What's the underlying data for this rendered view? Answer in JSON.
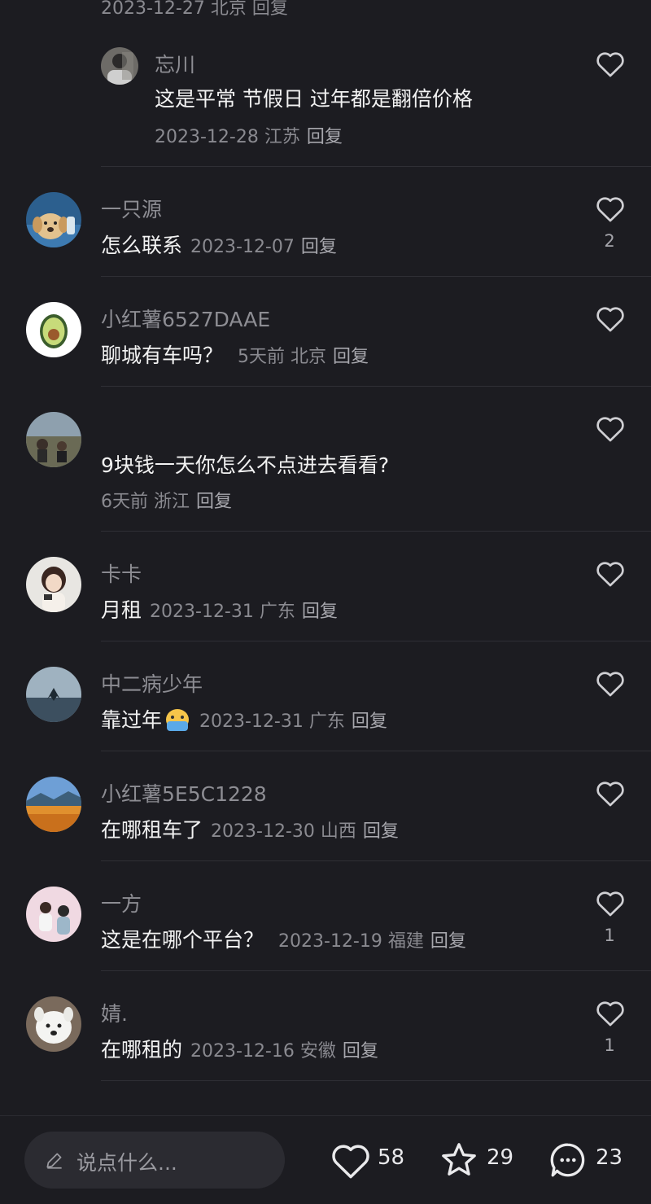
{
  "partial_top_meta": "2023-12-27 北京 回复",
  "reply_label": "回复",
  "sub_comment": {
    "name": "忘川",
    "text": "这是平常  节假日  过年都是翻倍价格",
    "meta": "2023-12-28 江苏"
  },
  "comments": [
    {
      "name": "一只源",
      "text": "怎么联系",
      "meta": "2023-12-07",
      "likes": "2",
      "avatar": "golden-retriever"
    },
    {
      "name": "小红薯6527DAAE",
      "text": "聊城有车吗？",
      "meta": "5天前 北京",
      "likes": "",
      "avatar": "avocado"
    },
    {
      "name": "",
      "text": "9块钱一天你怎么不点进去看看?",
      "meta": "6天前 浙江",
      "likes": "",
      "avatar": "landscape-people"
    },
    {
      "name": "卡卡",
      "text": "月租",
      "meta": "2023-12-31 广东",
      "likes": "",
      "avatar": "girl-camera"
    },
    {
      "name": "中二病少年",
      "text": "靠过年",
      "emoji": "crying-face-emoji",
      "meta": "2023-12-31 广东",
      "likes": "",
      "avatar": "whale"
    },
    {
      "name": "小红薯5E5C1228",
      "text": "在哪租车了",
      "meta": "2023-12-30 山西",
      "likes": "",
      "avatar": "flower-field"
    },
    {
      "name": "一方",
      "text": "这是在哪个平台？",
      "meta": "2023-12-19 福建",
      "likes": "1",
      "avatar": "couple-photo"
    },
    {
      "name": " 婧.",
      "text": "在哪租的",
      "meta": "2023-12-16 安徽",
      "likes": "1",
      "avatar": "samoyed"
    }
  ],
  "bottom_bar": {
    "input_placeholder": "说点什么...",
    "likes": "58",
    "favorites": "29",
    "comments": "23"
  },
  "colors": {
    "background": "#1c1c21",
    "secondary_text": "#8a8a90",
    "primary_text": "#f2f2f2"
  }
}
